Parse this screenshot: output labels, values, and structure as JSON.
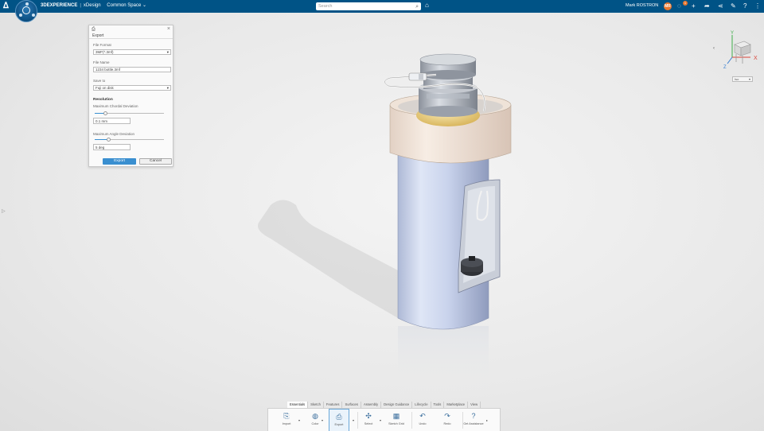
{
  "topbar": {
    "brand_bold": "3DEXPERIENCE",
    "app_name": "xDesign",
    "space_name": "Common Space",
    "search_placeholder": "Search",
    "user_name": "Mark ROSTRON",
    "user_initials": "MR",
    "notification_count": "1",
    "colors": {
      "bar": "#005386",
      "accent": "#e8772e"
    }
  },
  "export_panel": {
    "title": "Export",
    "file_format_label": "File Format",
    "file_format_value": "3MF(*.3mf)",
    "file_name_label": "File Name",
    "file_name_value": "1234 bottle.3mf",
    "save_to_label": "Save to",
    "save_to_value": "Fuji on disk",
    "resolution_label": "Resolution",
    "max_chordal_label": "Maximum Chordal Deviation",
    "max_chordal_value": "0.1 mm",
    "max_angle_label": "Maximum Angle Deviation",
    "max_angle_value": "5 deg",
    "export_button": "Export",
    "cancel_button": "Cancel"
  },
  "viewer": {
    "triad_axes": {
      "y": "Y",
      "x": "X",
      "z": "Z"
    },
    "view_select_value": "Iso"
  },
  "action_bar": {
    "tabs": [
      "Essentials",
      "Sketch",
      "Features",
      "Surfaces",
      "Assembly",
      "Design Guidance",
      "Lifecycle",
      "Tools",
      "Marketplace",
      "View"
    ],
    "active_tab": "Essentials",
    "actions": [
      {
        "label": "Import",
        "icon": "import-icon"
      },
      {
        "label": "Color",
        "icon": "color-icon"
      },
      {
        "label": "Export",
        "icon": "export-icon"
      },
      {
        "label": "Select",
        "icon": "select-icon"
      },
      {
        "label": "Sketch Grid",
        "icon": "sketch-grid-icon"
      },
      {
        "label": "Undo",
        "icon": "undo-icon"
      },
      {
        "label": "Redo",
        "icon": "redo-icon"
      },
      {
        "label": "Get Assistance",
        "icon": "help-icon"
      }
    ]
  }
}
